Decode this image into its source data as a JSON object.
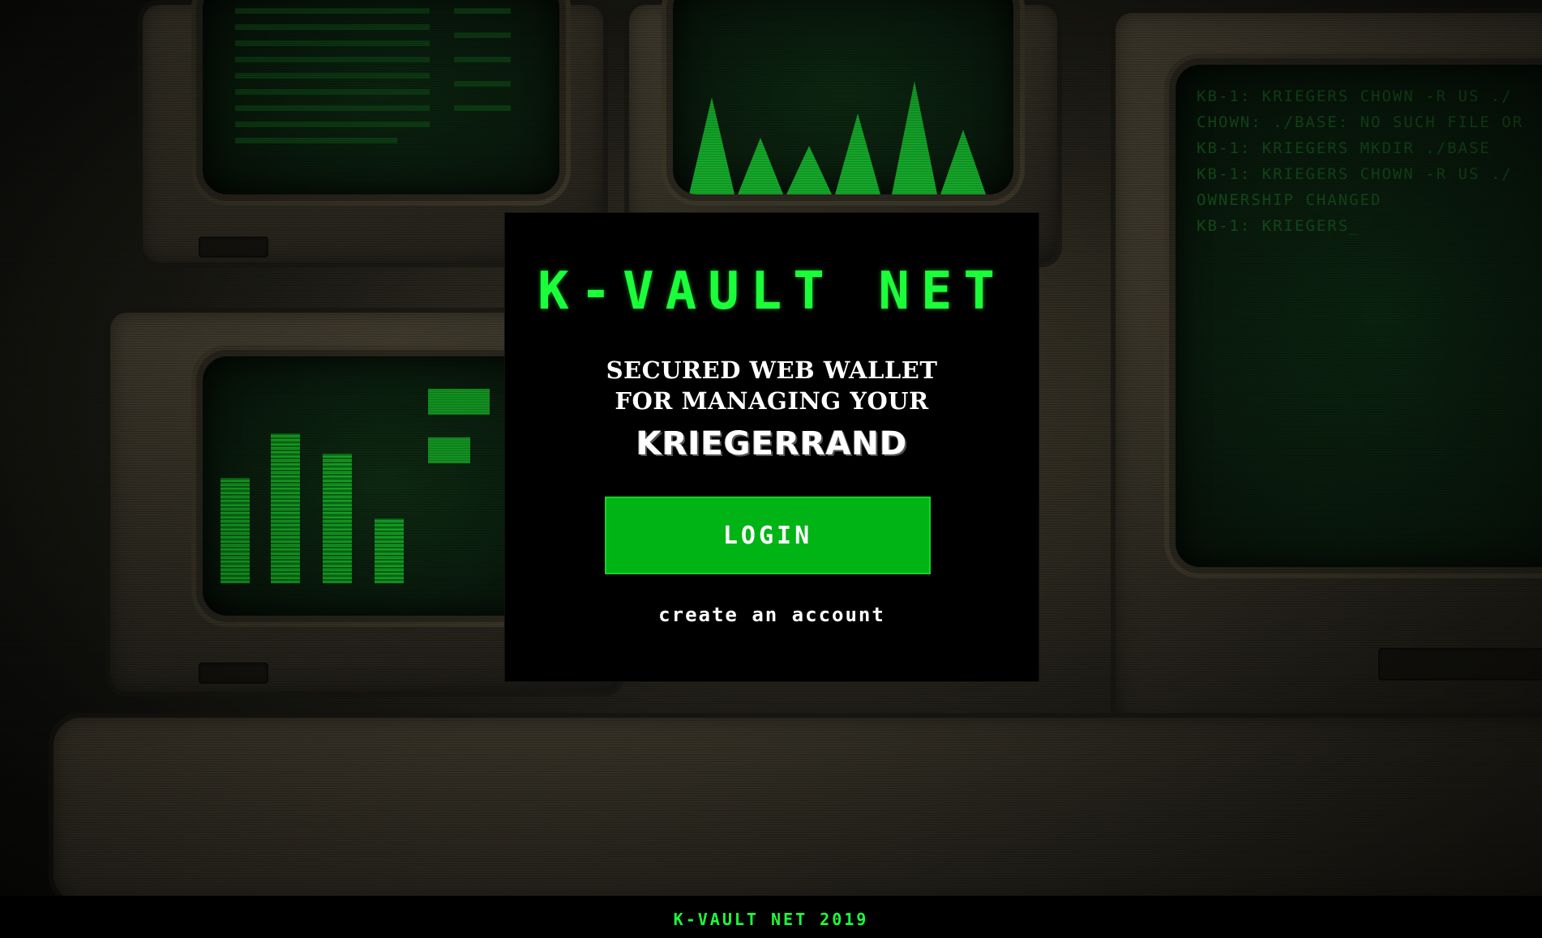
{
  "brand": {
    "title": "K-VAULT NET"
  },
  "hero": {
    "tagline_line1": "Secured web wallet",
    "tagline_line2": "for managing your",
    "currency_name": "KRIEGERRAND"
  },
  "actions": {
    "login_label": "LOGIN",
    "create_account_label": "create an account"
  },
  "footer": {
    "text": "K-VAULT NET 2019"
  },
  "background_terminal": {
    "lines": [
      "KB-1: KRIEGERS CHOWN -R US ./",
      "CHOWN: ./BASE: NO SUCH FILE OR",
      "KB-1: KRIEGERS MKDIR ./BASE",
      "KB-1: KRIEGERS CHOWN -R US ./",
      "OWNERSHIP CHANGED",
      "KB-1: KRIEGERS_"
    ]
  },
  "theme": {
    "accent": "#1bff3a",
    "button_bg": "#00b416",
    "panel_bg": "#000000"
  }
}
